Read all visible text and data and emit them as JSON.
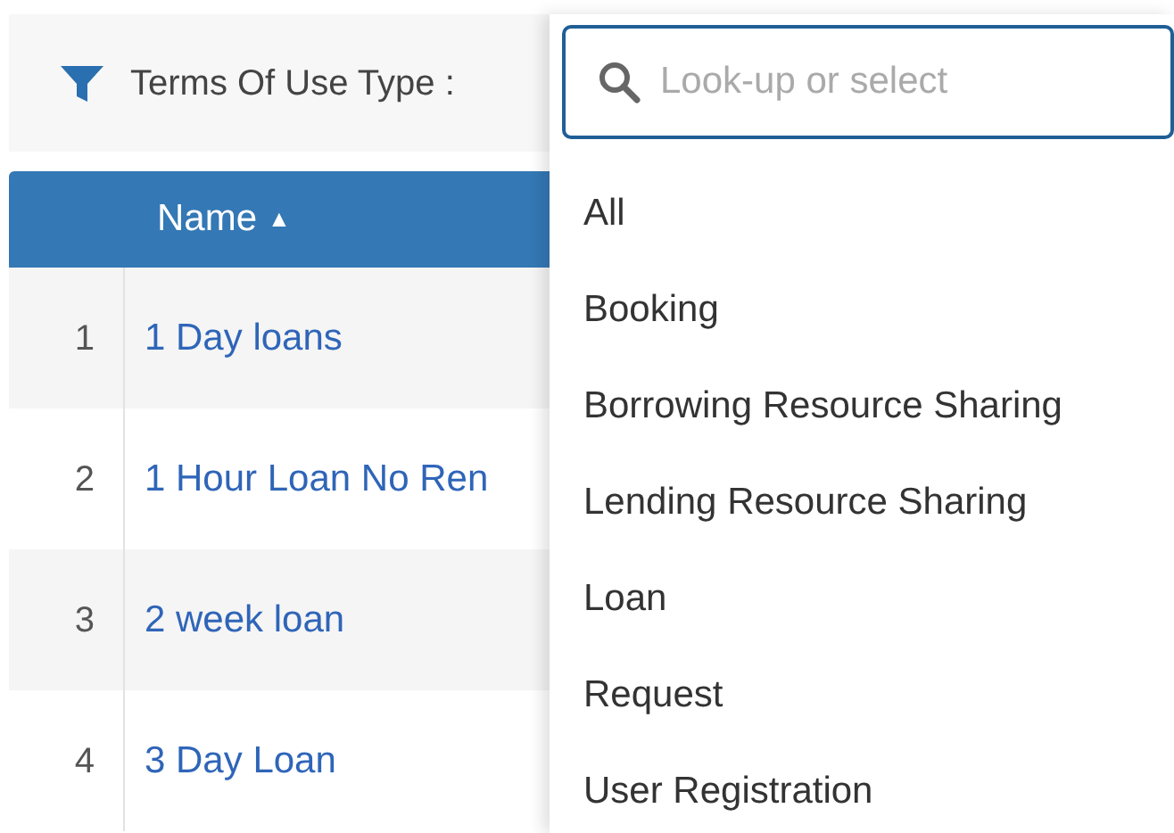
{
  "filter": {
    "label": "Terms Of Use Type :"
  },
  "table": {
    "columns": [
      {
        "label": "Name",
        "sort_indicator": "▲"
      }
    ],
    "rows": [
      {
        "number": "1",
        "name": "1 Day loans"
      },
      {
        "number": "2",
        "name": "1 Hour Loan No Ren"
      },
      {
        "number": "3",
        "name": "2 week loan"
      },
      {
        "number": "4",
        "name": "3 Day Loan"
      }
    ]
  },
  "dropdown": {
    "search": {
      "placeholder": "Look-up or select"
    },
    "options": [
      "All",
      "Booking",
      "Borrowing Resource Sharing",
      "Lending Resource Sharing",
      "Loan",
      "Request",
      "User Registration"
    ]
  }
}
